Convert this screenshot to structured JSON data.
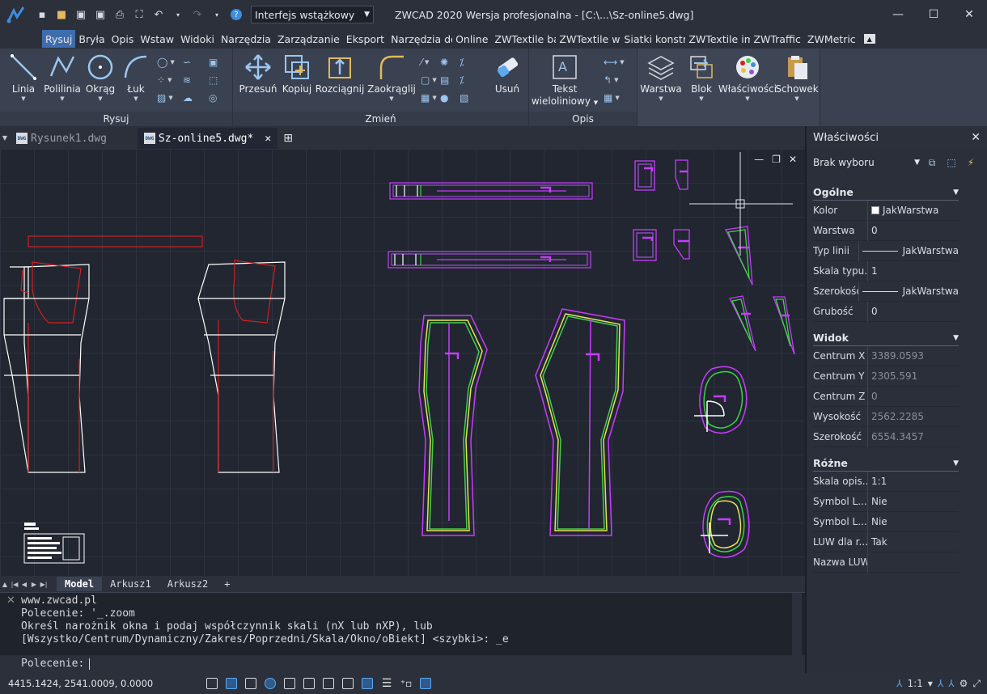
{
  "app": {
    "workspace": "Interfejs wstążkowy",
    "title": "ZWCAD 2020 Wersja profesjonalna - [C:\\...\\Sz-online5.dwg]"
  },
  "ribbon_tabs": [
    "Rysuj",
    "Bryła",
    "Opis",
    "Wstaw",
    "Widoki",
    "Narzędzia",
    "Zarządzanie",
    "Eksport",
    "Narzędzia do",
    "Online",
    "ZWTextile baz",
    "ZWTextile wyc",
    "Siatki konstru",
    "ZWTextile imp",
    "ZWTraffic",
    "ZWMetric"
  ],
  "ribbon": {
    "rysuj": {
      "label": "Rysuj",
      "linia": "Linia",
      "polilinia": "Polilinia",
      "okrag": "Okrąg",
      "luk": "Łuk"
    },
    "zmien": {
      "label": "Zmień",
      "przesun": "Przesuń",
      "kopiuj": "Kopiuj",
      "rozciagnij": "Rozciągnij",
      "zaokraglij": "Zaokrąglij",
      "usun": "Usuń"
    },
    "opis": {
      "label": "Opis",
      "tekst1": "Tekst",
      "tekst2": "wieloliniowy"
    },
    "warstwa": "Warstwa",
    "blok": "Blok",
    "wlasciwosci": "Właściwości",
    "schowek": "Schowek"
  },
  "doc_tabs": [
    {
      "label": "Rysunek1.dwg",
      "active": false
    },
    {
      "label": "Sz-online5.dwg*",
      "active": true
    }
  ],
  "layout_tabs": [
    "Model",
    "Arkusz1",
    "Arkusz2",
    "+"
  ],
  "command": {
    "history": [
      "www.zwcad.pl",
      "Polecenie: '_.zoom",
      "Określ narożnik okna i podaj współczynnik skali (nX lub nXP), lub",
      "[Wszystko/Centrum/Dynamiczny/Zakres/Poprzedni/Skala/Okno/oBiekt] <szybki>: _e"
    ],
    "prompt": "Polecenie:"
  },
  "status": {
    "coords": "4415.1424, 2541.0009, 0.0000",
    "scale": "1:1"
  },
  "properties": {
    "title": "Właściwości",
    "selection": "Brak wyboru",
    "groups": [
      {
        "title": "Ogólne",
        "rows": [
          {
            "name": "Kolor",
            "value": "JakWarstwa",
            "kind": "swatch"
          },
          {
            "name": "Warstwa",
            "value": "0",
            "kind": "text"
          },
          {
            "name": "Typ linii",
            "value": "JakWarstwa",
            "kind": "line"
          },
          {
            "name": "Skala typu...",
            "value": "1",
            "kind": "text"
          },
          {
            "name": "Szerokość...",
            "value": "JakWarstwa",
            "kind": "line"
          },
          {
            "name": "Grubość",
            "value": "0",
            "kind": "text"
          }
        ]
      },
      {
        "title": "Widok",
        "rows": [
          {
            "name": "Centrum X",
            "value": "3389.0593",
            "kind": "dim"
          },
          {
            "name": "Centrum Y",
            "value": "2305.591",
            "kind": "dim"
          },
          {
            "name": "Centrum Z",
            "value": "0",
            "kind": "dim"
          },
          {
            "name": "Wysokość",
            "value": "2562.2285",
            "kind": "dim"
          },
          {
            "name": "Szerokość",
            "value": "6554.3457",
            "kind": "dim"
          }
        ]
      },
      {
        "title": "Różne",
        "rows": [
          {
            "name": "Skala opis...",
            "value": "1:1",
            "kind": "text"
          },
          {
            "name": "Symbol L...",
            "value": "Nie",
            "kind": "text"
          },
          {
            "name": "Symbol L...",
            "value": "Nie",
            "kind": "text"
          },
          {
            "name": "LUW dla r...",
            "value": "Tak",
            "kind": "text"
          },
          {
            "name": "Nazwa LUW",
            "value": "",
            "kind": "text"
          }
        ]
      }
    ]
  },
  "colors": {
    "accent": "#3e6dad",
    "pattern_magenta": "#c83cff",
    "pattern_yellow": "#e8e25a",
    "pattern_green": "#3fd24a",
    "pattern_red": "#d22020",
    "pattern_white": "#ffffff"
  }
}
